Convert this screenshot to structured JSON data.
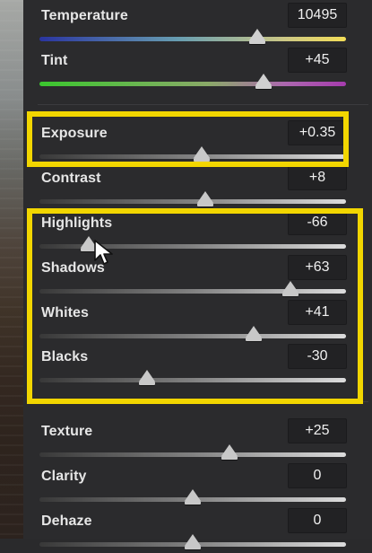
{
  "colors": {
    "highlight": "#f2d600"
  },
  "sliders": [
    {
      "id": "temperature",
      "label": "Temperature",
      "value": "10495",
      "position": 0.71,
      "track": "temp"
    },
    {
      "id": "tint",
      "label": "Tint",
      "value": "+45",
      "position": 0.73,
      "track": "tint"
    },
    {
      "id": "exposure",
      "label": "Exposure",
      "value": "+0.35",
      "position": 0.53,
      "track": "gray"
    },
    {
      "id": "contrast",
      "label": "Contrast",
      "value": "+8",
      "position": 0.54,
      "track": "gray"
    },
    {
      "id": "highlights",
      "label": "Highlights",
      "value": "-66",
      "position": 0.16,
      "track": "gray"
    },
    {
      "id": "shadows",
      "label": "Shadows",
      "value": "+63",
      "position": 0.82,
      "track": "gray"
    },
    {
      "id": "whites",
      "label": "Whites",
      "value": "+41",
      "position": 0.7,
      "track": "gray"
    },
    {
      "id": "blacks",
      "label": "Blacks",
      "value": "-30",
      "position": 0.35,
      "track": "gray"
    },
    {
      "id": "texture",
      "label": "Texture",
      "value": "+25",
      "position": 0.62,
      "track": "gray"
    },
    {
      "id": "clarity",
      "label": "Clarity",
      "value": "0",
      "position": 0.5,
      "track": "gray"
    },
    {
      "id": "dehaze",
      "label": "Dehaze",
      "value": "0",
      "position": 0.5,
      "track": "gray"
    }
  ]
}
